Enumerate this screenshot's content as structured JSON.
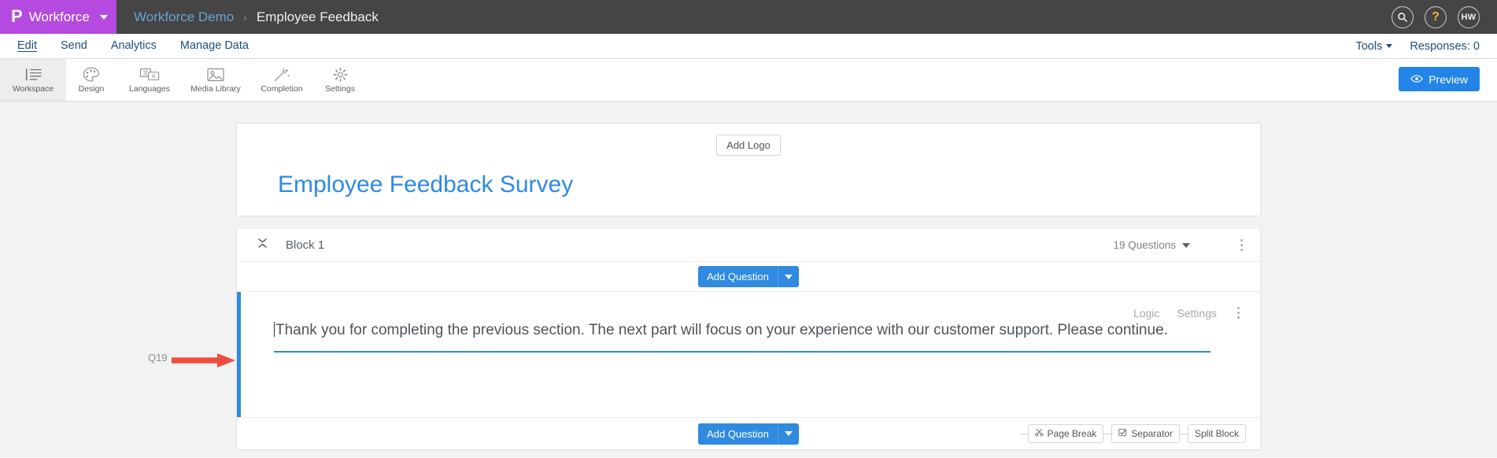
{
  "header": {
    "brand_logo": "P",
    "brand_name": "Workforce",
    "breadcrumb_parent": "Workforce Demo",
    "breadcrumb_sep": "›",
    "breadcrumb_current": "Employee Feedback",
    "search_icon": "search-icon",
    "help_label": "?",
    "avatar_initials": "HW",
    "brand_color": "#b44ae0",
    "bar_color": "#454545"
  },
  "nav": {
    "items": [
      {
        "label": "Edit",
        "active": true
      },
      {
        "label": "Send",
        "active": false
      },
      {
        "label": "Analytics",
        "active": false
      },
      {
        "label": "Manage Data",
        "active": false
      }
    ],
    "tools_label": "Tools",
    "responses_label": "Responses: 0",
    "link_color": "#1d4f7c"
  },
  "toolbar": {
    "items": [
      {
        "label": "Workspace",
        "icon": "workspace-icon",
        "active": true
      },
      {
        "label": "Design",
        "icon": "palette-icon",
        "active": false
      },
      {
        "label": "Languages",
        "icon": "translate-icon",
        "active": false
      },
      {
        "label": "Media Library",
        "icon": "image-icon",
        "active": false
      },
      {
        "label": "Completion",
        "icon": "magic-wand-icon",
        "active": false
      },
      {
        "label": "Settings",
        "icon": "gear-icon",
        "active": false
      }
    ],
    "preview_label": "Preview",
    "preview_icon": "eye-icon",
    "preview_color": "#2384e8"
  },
  "survey": {
    "add_logo_label": "Add Logo",
    "title": "Employee Feedback Survey",
    "title_color": "#2f8ae0"
  },
  "block": {
    "collapse_icon": "collapse-icon",
    "name": "Block 1",
    "question_count_label": "19 Questions",
    "menu_icon": "kebab-menu-icon",
    "add_question_label": "Add Question",
    "add_question_caret_icon": "chevron-down-icon"
  },
  "question": {
    "id_label": "Q19",
    "logic_label": "Logic",
    "settings_label": "Settings",
    "menu_icon": "kebab-menu-icon",
    "text": "Thank you for completing the previous section. The next part will focus on your experience with our customer support. Please continue.",
    "accent_color": "#2f8ae0",
    "annotation_icon": "red-arrow-pointer",
    "annotation_color": "#ef4d3c"
  },
  "block_footer": {
    "add_question_label": "Add Question",
    "page_break_label": "Page Break",
    "page_break_icon": "scissors-icon",
    "separator_label": "Separator",
    "separator_icon": "checkbox-icon",
    "split_block_label": "Split Block"
  }
}
